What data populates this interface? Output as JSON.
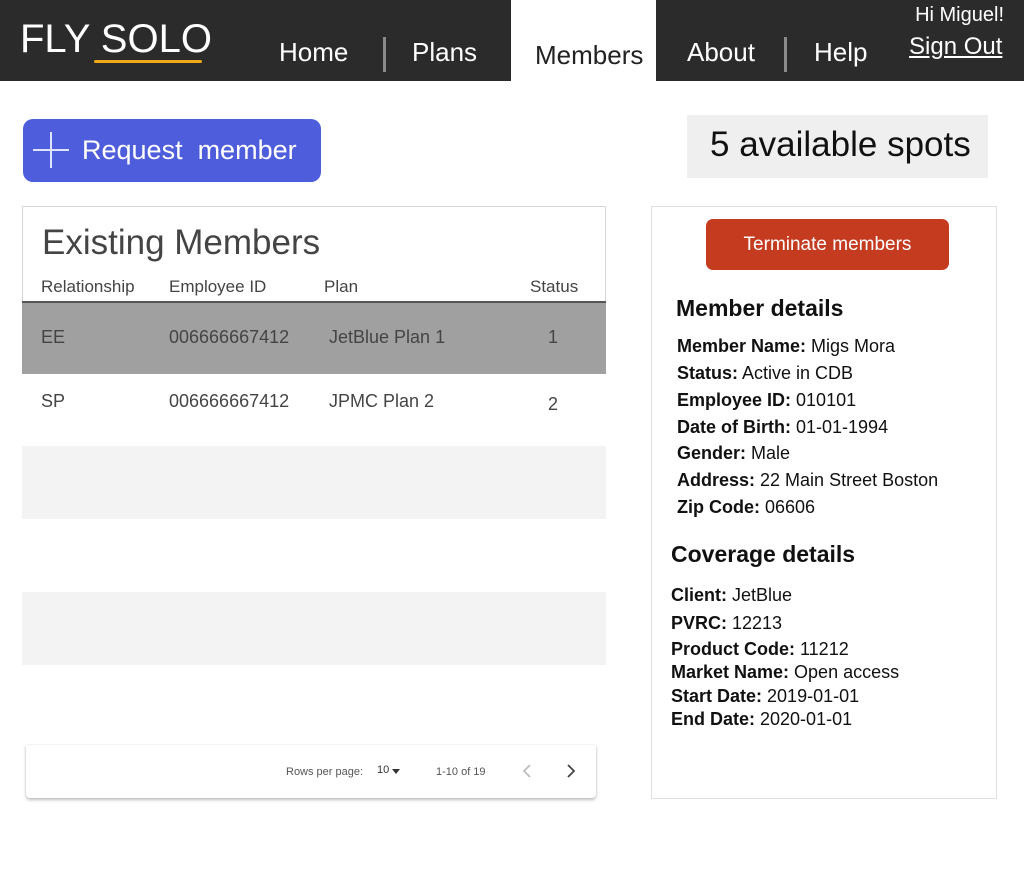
{
  "header": {
    "logo": "FLY SOLO",
    "nav": {
      "home": "Home",
      "plans": "Plans",
      "members": "Members",
      "about": "About",
      "help": "Help"
    },
    "greeting": "Hi Miguel!",
    "sign_out": "Sign Out"
  },
  "actions": {
    "request_member": "Request  member",
    "available_spots": "5 available spots",
    "terminate_members": "Terminate members"
  },
  "members": {
    "title": "Existing Members",
    "columns": [
      "Relationship",
      "Employee ID",
      "Plan",
      "Status"
    ],
    "rows": [
      {
        "relationship": "EE",
        "employee_id": "006666667412",
        "plan": "JetBlue Plan 1",
        "status": "1"
      },
      {
        "relationship": "SP",
        "employee_id": "006666667412",
        "plan": "JPMC Plan 2",
        "status": "2"
      }
    ],
    "pagination": {
      "rows_per_page_label": "Rows per page:",
      "rows_per_page_value": "10",
      "range": "1-10 of 19"
    }
  },
  "member_details": {
    "title": "Member details",
    "fields": [
      {
        "label": "Member Name:",
        "value": " Migs Mora"
      },
      {
        "label": "Status:",
        "value": " Active in CDB"
      },
      {
        "label": "Employee ID:",
        "value": " 010101"
      },
      {
        "label": "Date of Birth:",
        "value": " 01-01-1994"
      },
      {
        "label": "Gender:",
        "value": " Male"
      },
      {
        "label": "Address:",
        "value": " 22 Main Street Boston"
      },
      {
        "label": "Zip Code:",
        "value": " 06606"
      }
    ]
  },
  "coverage_details": {
    "title": "Coverage details",
    "fields": [
      {
        "label": "Client:",
        "value": " JetBlue"
      },
      {
        "label": "PVRC:",
        "value": " 12213"
      },
      {
        "label": "Product Code:",
        "value": " 11212"
      },
      {
        "label": "Market Name:",
        "value": "  Open access"
      },
      {
        "label": "Start Date:",
        "value": "  2019-01-01"
      },
      {
        "label": "End Date:",
        "value": "  2020-01-01"
      }
    ]
  },
  "colors": {
    "topbar": "#2b2b2b",
    "logo_accent": "#f2a916",
    "request_button": "#4e5ddc",
    "terminate_button": "#c43b20",
    "selected_row": "#a0a0a0"
  },
  "icons": {
    "request": "plus-icon",
    "rows_select": "caret-down-icon",
    "prev_page": "chevron-left-icon",
    "next_page": "chevron-right-icon"
  }
}
